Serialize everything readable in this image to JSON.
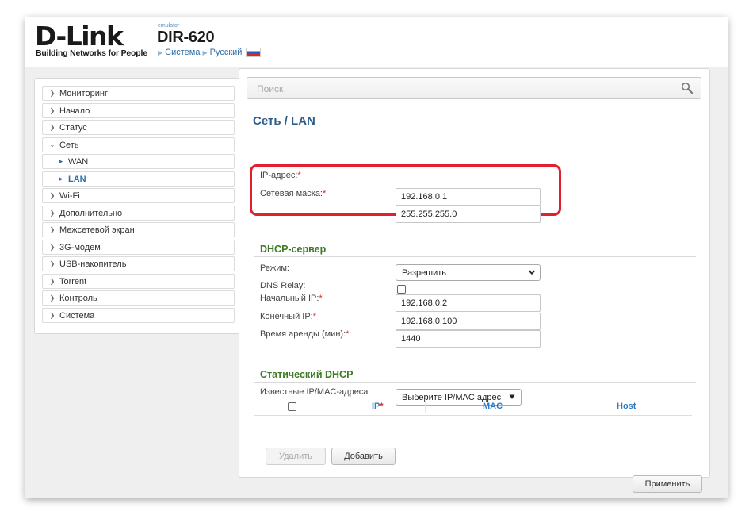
{
  "header": {
    "logo": "D-Link",
    "tagline": "Building Networks for People",
    "emulator": "emulator",
    "model": "DIR-620",
    "breadcrumb": [
      "Система",
      "Русский"
    ]
  },
  "sidebar": {
    "items": [
      {
        "label": "Мониторинг",
        "icon": "circle-arrow-right-icon"
      },
      {
        "label": "Начало",
        "icon": "circle-arrow-right-icon"
      },
      {
        "label": "Статус",
        "icon": "circle-arrow-right-icon"
      },
      {
        "label": "Сеть",
        "icon": "circle-arrow-down-icon",
        "expanded": true
      },
      {
        "label": "WAN",
        "icon": "triangle-right-icon",
        "sub": true
      },
      {
        "label": "LAN",
        "icon": "triangle-right-icon",
        "sub": true,
        "active": true
      },
      {
        "label": "Wi-Fi",
        "icon": "circle-arrow-right-icon"
      },
      {
        "label": "Дополнительно",
        "icon": "circle-arrow-right-icon"
      },
      {
        "label": "Межсетевой экран",
        "icon": "circle-arrow-right-icon"
      },
      {
        "label": "3G-модем",
        "icon": "circle-arrow-right-icon"
      },
      {
        "label": "USB-накопитель",
        "icon": "circle-arrow-right-icon"
      },
      {
        "label": "Torrent",
        "icon": "circle-arrow-right-icon"
      },
      {
        "label": "Контроль",
        "icon": "circle-arrow-right-icon"
      },
      {
        "label": "Система",
        "icon": "circle-arrow-right-icon"
      }
    ]
  },
  "search": {
    "placeholder": "Поиск"
  },
  "page": {
    "title": "Сеть /  LAN"
  },
  "lan": {
    "ip_label": "IP-адрес:",
    "ip_value": "192.168.0.1",
    "mask_label": "Сетевая маска:",
    "mask_value": "255.255.255.0",
    "required_mark": "*"
  },
  "dhcp": {
    "section_title": "DHCP-сервер",
    "mode_label": "Режим:",
    "mode_value": "Разрешить",
    "dns_relay_label": "DNS Relay:",
    "dns_relay_checked": false,
    "start_ip_label": "Начальный IP:",
    "start_ip_value": "192.168.0.2",
    "end_ip_label": "Конечный IP:",
    "end_ip_value": "192.168.0.100",
    "lease_label": "Время аренды (мин):",
    "lease_value": "1440"
  },
  "static_dhcp": {
    "section_title": "Статический DHCP",
    "known_label": "Известные IP/MAC-адреса:",
    "known_select": "Выберите IP/MAC адрес",
    "columns": [
      "IP",
      "MAC",
      "Host"
    ],
    "ip_required": "*"
  },
  "buttons": {
    "delete": "Удалить",
    "add": "Добавить",
    "apply": "Применить"
  },
  "colors": {
    "accent_blue": "#2e5c8a",
    "section_green": "#3c7a23",
    "highlight_red": "#e0202f",
    "required_red": "#d32f2f"
  }
}
